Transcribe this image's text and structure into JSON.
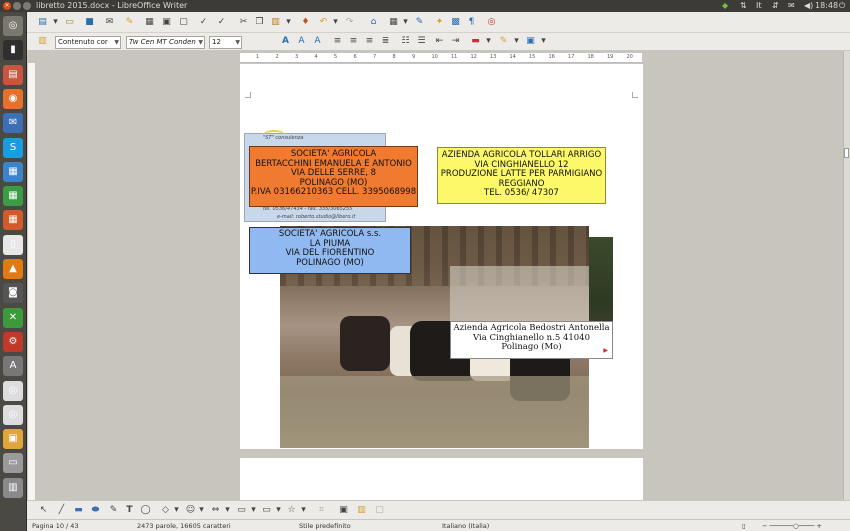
{
  "window": {
    "title": "libretto 2015.docx - LibreOffice Writer",
    "clock": "18:48",
    "tray_icons": [
      "shield-icon",
      "sort-icon",
      "keyboard-layout-icon",
      "network-icon",
      "mail-icon",
      "volume-icon",
      "power-icon"
    ]
  },
  "launcher": {
    "items": [
      {
        "name": "dash-icon",
        "color": "#7a786f",
        "glyph": "◎"
      },
      {
        "name": "terminal-icon",
        "color": "#2f2f2f",
        "glyph": "▮"
      },
      {
        "name": "files-icon",
        "color": "#c8553d",
        "glyph": "▤"
      },
      {
        "name": "firefox-icon",
        "color": "#e4722a",
        "glyph": "◉"
      },
      {
        "name": "thunderbird-icon",
        "color": "#3d6fb6",
        "glyph": "✉"
      },
      {
        "name": "skype-icon",
        "color": "#1c9ce0",
        "glyph": "S"
      },
      {
        "name": "writer-icon",
        "color": "#3c84c9",
        "glyph": "▦"
      },
      {
        "name": "calc-icon",
        "color": "#3c9c46",
        "glyph": "▦"
      },
      {
        "name": "impress-icon",
        "color": "#d25b2c",
        "glyph": "▦"
      },
      {
        "name": "document-icon",
        "color": "#e8e8e8",
        "glyph": "▯"
      },
      {
        "name": "vlc-icon",
        "color": "#e37a11",
        "glyph": "▲"
      },
      {
        "name": "camera-icon",
        "color": "#555555",
        "glyph": "◙"
      },
      {
        "name": "xmind-icon",
        "color": "#3d9a3a",
        "glyph": "✕"
      },
      {
        "name": "settings-icon",
        "color": "#c0392b",
        "glyph": "⚙"
      },
      {
        "name": "software-center-icon",
        "color": "#777777",
        "glyph": "A"
      },
      {
        "name": "disc-icon",
        "color": "#dddddd",
        "glyph": "◎"
      },
      {
        "name": "disc-2-icon",
        "color": "#dddddd",
        "glyph": "◎"
      },
      {
        "name": "archive-icon",
        "color": "#e0a63a",
        "glyph": "▣"
      },
      {
        "name": "drive-icon",
        "color": "#9a9a9a",
        "glyph": "▭"
      },
      {
        "name": "trash-icon",
        "color": "#8a8a8a",
        "glyph": "▥"
      }
    ]
  },
  "toolbar": {
    "paragraph_style": "Contenuto cor",
    "font_name": "Tw Cen MT Conden",
    "font_size": "12"
  },
  "document": {
    "card_back_text": [
      "\"ST\" consulenza",
      "tel. 0536/47434 - fax. 335/3065255",
      "e-mail: roberto.studio@libero.it"
    ],
    "orange_box": [
      "SOCIETA' AGRICOLA",
      "BERTACCHINI EMANUELA E ANTONIO",
      "VIA DELLE SERRE, 8",
      "POLINAGO (MO)",
      "P.IVA 03166210363 CELL. 3395068998"
    ],
    "yellow_box": [
      "AZIENDA AGRICOLA TOLLARI ARRIGO",
      "VIA CINGHIANELLO 12",
      "PRODUZIONE LATTE PER PARMIGIANO",
      "REGGIANO",
      "TEL. 0536/ 47307"
    ],
    "blue_box": [
      "SOCIETA' AGRICOLA s.s.",
      "LA PIUMA",
      "VIA DEL FIORENTINO",
      "POLINAGO (MO)"
    ],
    "white_box": [
      "Azienda Agricola Bedostri Antonella",
      "Via Cinghianello n.5 41040",
      "Polinago (Mo)"
    ]
  },
  "ruler_numbers": [
    "1",
    "2",
    "3",
    "4",
    "5",
    "6",
    "7",
    "8",
    "9",
    "10",
    "11",
    "12",
    "13",
    "14",
    "15",
    "16",
    "17",
    "18",
    "19",
    "20"
  ],
  "status": {
    "page": "Pagina 10 / 43",
    "words": "2473 parole, 16605 caratteri",
    "style": "Stile predefinito",
    "language": "Italiano (Italia)"
  }
}
